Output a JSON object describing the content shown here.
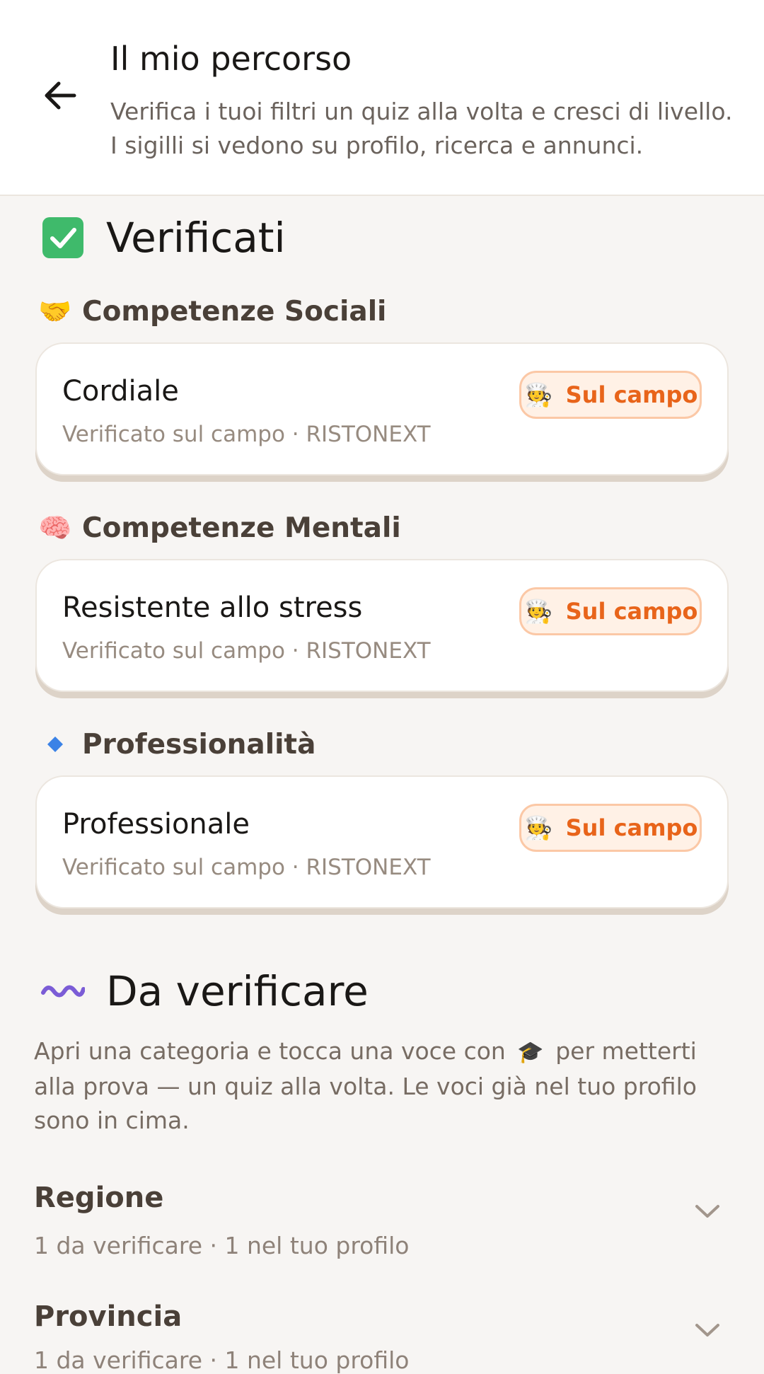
{
  "header": {
    "title": "Il mio percorso",
    "subtitle": "Verifica i tuoi filtri un quiz alla volta e cresci di livello. I sigilli si vedono su profilo, ricerca e annunci."
  },
  "verified": {
    "title": "Verificati",
    "icon": "check-box-icon",
    "categories": [
      {
        "label": "Competenze Sociali",
        "emoji": "🤝",
        "item": {
          "title": "Cordiale",
          "subtitle": "Verificato sul campo · RISTONEXT",
          "badge": "Sul campo"
        }
      },
      {
        "label": "Competenze Mentali",
        "emoji": "🧠",
        "item": {
          "title": "Resistente allo stress",
          "subtitle": "Verificato sul campo · RISTONEXT",
          "badge": "Sul campo"
        }
      },
      {
        "label": "Professionalità",
        "emoji": "🔹",
        "item": {
          "title": "Professionale",
          "subtitle": "Verificato sul campo · RISTONEXT",
          "badge": "Sul campo"
        }
      }
    ]
  },
  "to_verify": {
    "title": "Da verificare",
    "icon": "wavy-line-icon",
    "description_before": "Apri una categoria e tocca una voce con",
    "description_icon": "🎓",
    "description_after": "per metterti alla prova — un quiz alla volta. Le voci già nel tuo profilo sono in cima.",
    "sections": [
      {
        "title": "Regione",
        "subtitle": "1 da verificare · 1 nel tuo profilo"
      },
      {
        "title": "Provincia",
        "subtitle": "1 da verificare · 1 nel tuo profilo"
      }
    ]
  },
  "colors": {
    "accent_orange": "#e8641a",
    "check_green": "#3fba6b",
    "wave_purple": "#7b5cd6"
  }
}
